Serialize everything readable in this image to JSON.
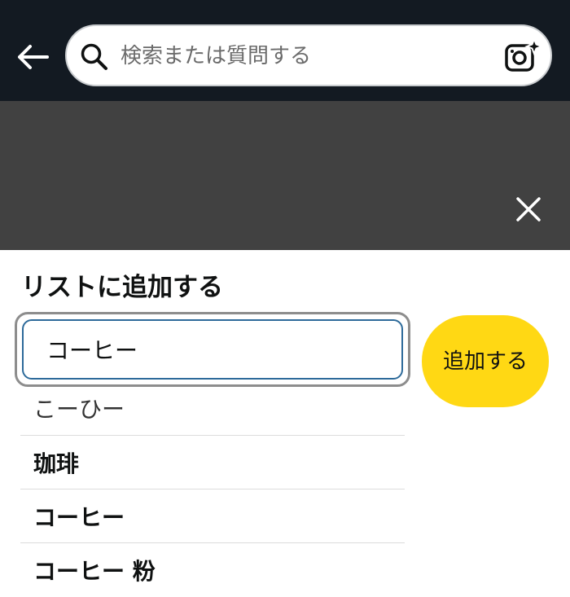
{
  "header": {
    "back_icon": "arrow-left-icon",
    "search": {
      "placeholder": "検索または質問する",
      "value": "",
      "search_icon": "search-icon",
      "camera_icon": "camera-sparkle-icon"
    }
  },
  "overlay": {
    "close_icon": "close-icon"
  },
  "panel": {
    "title": "リストに追加する",
    "input_value": "コーヒー",
    "add_button_label": "追加する",
    "accent_color": "#ffd814",
    "suggestions": [
      {
        "label": "こーひー"
      },
      {
        "label": "珈琲"
      },
      {
        "label": "コーヒー"
      },
      {
        "label": "コーヒー 粉"
      }
    ]
  }
}
